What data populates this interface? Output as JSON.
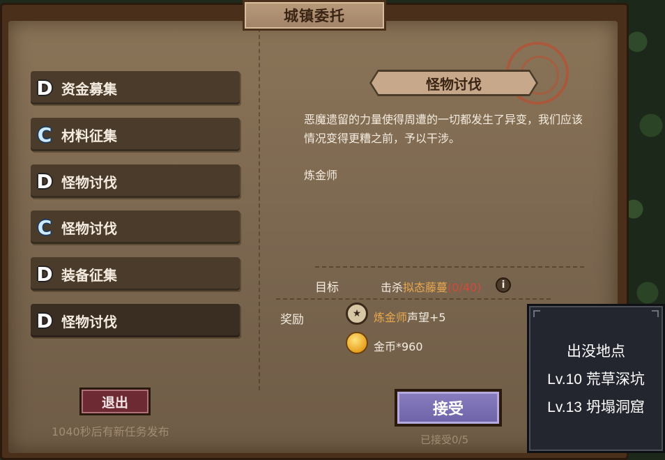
{
  "window": {
    "title": "城镇委托"
  },
  "quest_list": [
    {
      "rank": "D",
      "label": "资金募集"
    },
    {
      "rank": "C",
      "label": "材料征集"
    },
    {
      "rank": "D",
      "label": "怪物讨伐"
    },
    {
      "rank": "C",
      "label": "怪物讨伐"
    },
    {
      "rank": "D",
      "label": "装备征集"
    },
    {
      "rank": "D",
      "label": "怪物讨伐"
    }
  ],
  "exit_button": "退出",
  "refresh_note": "1040秒后有新任务发布",
  "detail": {
    "title": "怪物讨伐",
    "description": "恶魔遗留的力量使得周遭的一切都发生了异变，我们应该情况变得更糟之前，予以干涉。",
    "client": "炼金师",
    "goal_label": "目标",
    "goal_prefix": "击杀",
    "goal_target": "拟态藤蔓",
    "goal_progress": "(0/40)",
    "info_icon": "i",
    "reward_label": "奖励",
    "rewards": [
      {
        "icon": "medal-icon",
        "highlight": "炼金师",
        "text": "声望+5"
      },
      {
        "icon": "coin-icon",
        "text": "金币*960"
      }
    ]
  },
  "accept_button": "接受",
  "accepted_note": "已接受0/5",
  "tooltip": {
    "title": "出没地点",
    "locations": [
      "Lv.10 荒草深坑",
      "Lv.13 坍塌洞窟"
    ]
  },
  "colors": {
    "highlight": "#e8a850",
    "progress": "#d14a3a",
    "accept": "#7a6eb4",
    "exit": "#6e2a32"
  }
}
